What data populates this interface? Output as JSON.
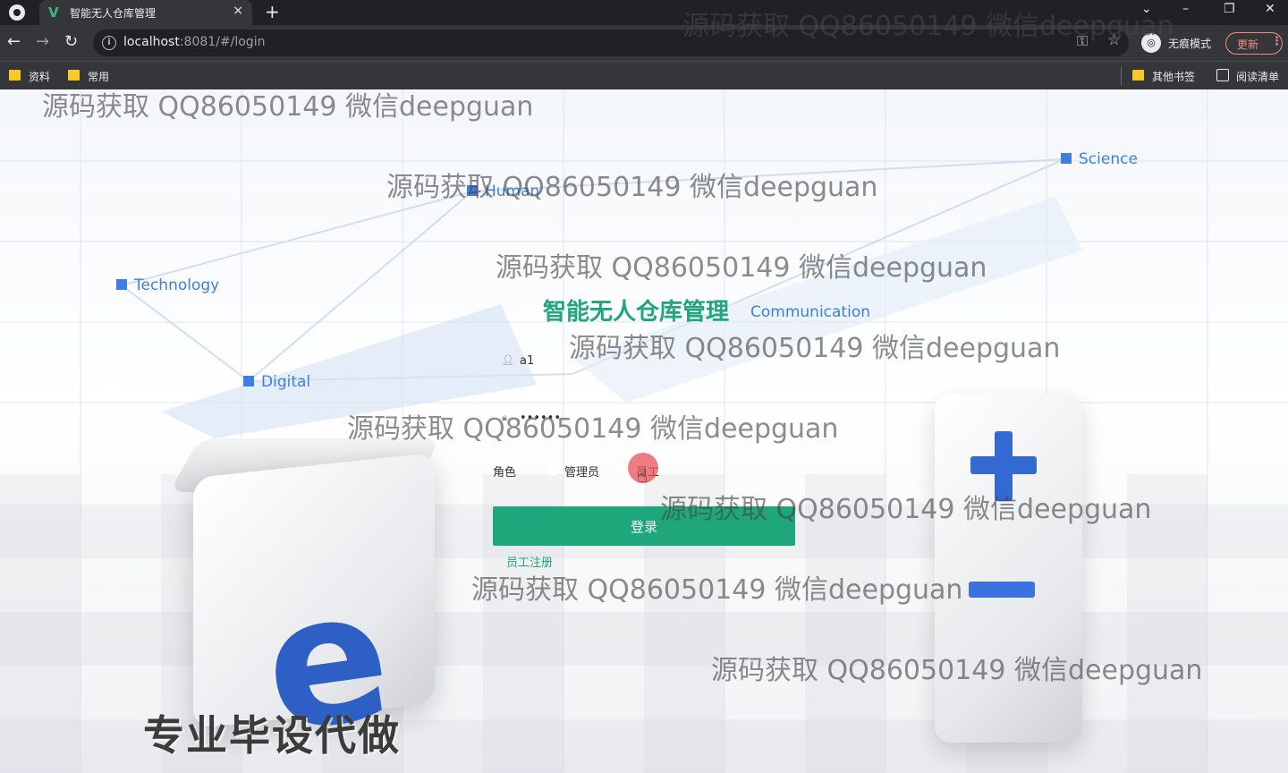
{
  "browser": {
    "tab_title": "智能无人仓库管理",
    "tab_favicon": "V",
    "tab_close": "×",
    "new_tab": "+",
    "url_host": "localhost",
    "url_rest": ":8081/#/login",
    "incognito_label": "无痕模式",
    "incognito_icon": "incognito-icon",
    "update_label": "更新",
    "bookmarks": [
      "资料",
      "常用"
    ],
    "other_bookmarks": "其他书签",
    "reading_list": "阅读清单"
  },
  "background_labels": {
    "science": "Science",
    "human": "Human",
    "technology": "Technology",
    "communication": "Communication",
    "digital": "Digital"
  },
  "login": {
    "title": "智能无人仓库管理",
    "username_value": "a1",
    "password_value": "••••••",
    "role_label": "角色",
    "role_options": [
      "管理员",
      "员工"
    ],
    "role_selected": "员工",
    "submit_label": "登录",
    "register_link": "员工注册"
  },
  "promo": "专业毕设代做",
  "watermark": "源码获取 QQ86050149 微信deepguan",
  "colors": {
    "brand_green": "#1fa67a",
    "accent_blue": "#3d7fe0",
    "chrome_dark": "#202124"
  }
}
